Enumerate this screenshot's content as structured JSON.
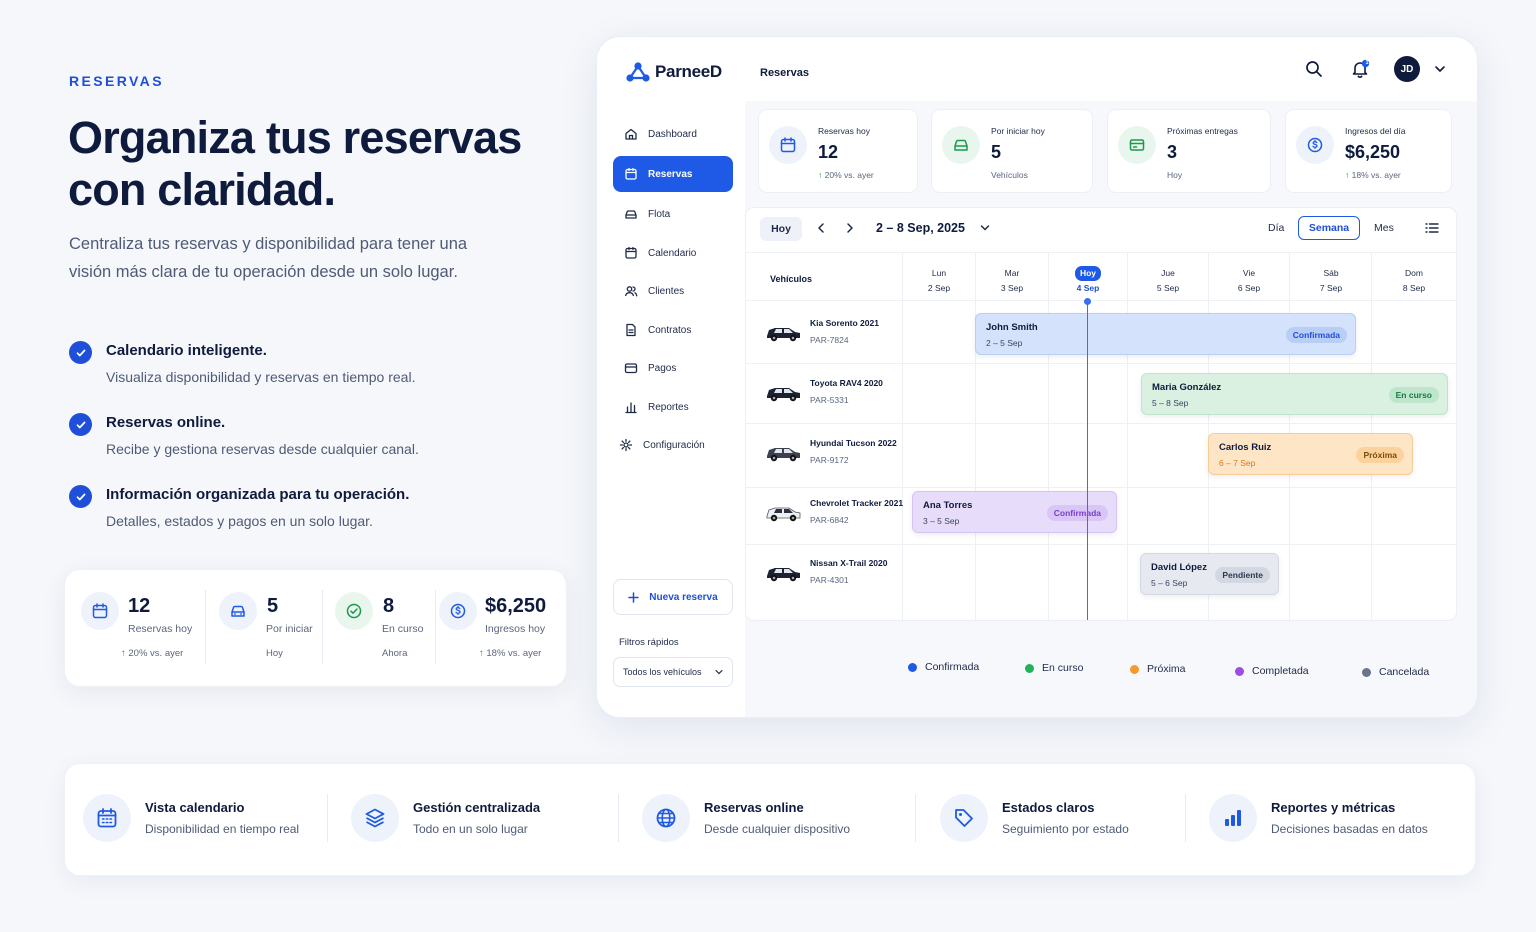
{
  "landing": {
    "eyebrow": "RESERVAS",
    "title": "Organiza tus reservas con claridad.",
    "lead": "Centraliza tus reservas y disponibilidad para tener una visión más clara de tu operación desde un solo lugar.",
    "features": [
      {
        "title": "Calendario inteligente.",
        "desc": "Visualiza disponibilidad y reservas en tiempo real."
      },
      {
        "title": "Reservas online.",
        "desc": "Recibe y gestiona reservas desde cualquier canal."
      },
      {
        "title": "Información organizada para tu operación.",
        "desc": "Detalles, estados y pagos en un solo lugar."
      }
    ],
    "stats": [
      {
        "icon": "calendar-icon",
        "value": "12",
        "label": "Reservas hoy",
        "sub": "20% vs. ayer"
      },
      {
        "icon": "car-icon",
        "value": "5",
        "label": "Por iniciar",
        "sub": "Hoy"
      },
      {
        "icon": "check-circle-icon",
        "value": "8",
        "label": "En curso",
        "sub": "Ahora"
      },
      {
        "icon": "dollar-icon",
        "value": "$6,250",
        "label": "Ingresos hoy",
        "sub": "18% vs. ayer"
      }
    ]
  },
  "app": {
    "brand": "ParneeD",
    "title": "Reservas",
    "avatar": "JD",
    "notifications": "1",
    "nav": [
      {
        "label": "Dashboard",
        "icon": "home-icon"
      },
      {
        "label": "Reservas",
        "icon": "calendar-icon"
      },
      {
        "label": "Flota",
        "icon": "car-icon"
      },
      {
        "label": "Calendario",
        "icon": "calendar-icon"
      },
      {
        "label": "Clientes",
        "icon": "users-icon"
      },
      {
        "label": "Contratos",
        "icon": "document-icon"
      },
      {
        "label": "Pagos",
        "icon": "wallet-icon"
      },
      {
        "label": "Reportes",
        "icon": "chart-icon"
      },
      {
        "label": "Configuración",
        "icon": "gear-icon"
      }
    ],
    "new_button": "Nueva reserva",
    "filters_title": "Filtros rápidos",
    "filter_value": "Todos los vehículos",
    "kpis": [
      {
        "label": "Reservas hoy",
        "value": "12",
        "sub": "20% vs. ayer",
        "icon": "calendar-icon",
        "color": "#1f5ae6"
      },
      {
        "label": "Por iniciar hoy",
        "value": "5",
        "sub": "Vehículos",
        "icon": "car-icon",
        "color": "#1a9a4b"
      },
      {
        "label": "Próximas entregas",
        "value": "3",
        "sub": "Hoy",
        "icon": "card-icon",
        "color": "#1a9a4b"
      },
      {
        "label": "Ingresos del día",
        "value": "$6,250",
        "sub": "18% vs. ayer",
        "icon": "dollar-icon",
        "color": "#1f5ae6"
      }
    ],
    "calendar": {
      "today_button": "Hoy",
      "range": "2 – 8 Sep, 2025",
      "views": [
        "Día",
        "Semana",
        "Mes"
      ],
      "active_view": "Semana",
      "vehicles_header": "Vehículos",
      "days": [
        {
          "name": "Lun",
          "date": "2 Sep"
        },
        {
          "name": "Mar",
          "date": "3 Sep"
        },
        {
          "name": "Hoy",
          "date": "4 Sep"
        },
        {
          "name": "Jue",
          "date": "5 Sep"
        },
        {
          "name": "Vie",
          "date": "6 Sep"
        },
        {
          "name": "Sáb",
          "date": "7 Sep"
        },
        {
          "name": "Dom",
          "date": "8 Sep"
        }
      ],
      "vehicles": [
        {
          "name": "Kia Sorento 2021",
          "plate": "PAR-7824"
        },
        {
          "name": "Toyota RAV4 2020",
          "plate": "PAR-5331"
        },
        {
          "name": "Hyundai Tucson 2022",
          "plate": "PAR-9172"
        },
        {
          "name": "Chevrolet Tracker 2021",
          "plate": "PAR-6842"
        },
        {
          "name": "Nissan X-Trail 2020",
          "plate": "PAR-4301"
        }
      ],
      "bookings": [
        {
          "name": "John Smith",
          "dates": "2 – 5 Sep",
          "status": "Confirmada"
        },
        {
          "name": "Maria González",
          "dates": "5 – 8 Sep",
          "status": "En curso"
        },
        {
          "name": "Carlos Ruiz",
          "dates": "6 – 7 Sep",
          "status": "Próxima"
        },
        {
          "name": "Ana Torres",
          "dates": "3 – 5 Sep",
          "status": "Confirmada"
        },
        {
          "name": "David López",
          "dates": "5 – 6 Sep",
          "status": "Pendiente"
        }
      ]
    },
    "legend": [
      {
        "label": "Confirmada",
        "color": "#1f5ae6"
      },
      {
        "label": "En curso",
        "color": "#22b35a"
      },
      {
        "label": "Próxima",
        "color": "#f59a2b"
      },
      {
        "label": "Completada",
        "color": "#9b4fe0"
      },
      {
        "label": "Cancelada",
        "color": "#6b7588"
      }
    ]
  },
  "benefits": [
    {
      "icon": "calendar-grid-icon",
      "title": "Vista calendario",
      "desc": "Disponibilidad en tiempo real"
    },
    {
      "icon": "layers-icon",
      "title": "Gestión centralizada",
      "desc": "Todo en un solo lugar"
    },
    {
      "icon": "globe-icon",
      "title": "Reservas online",
      "desc": "Desde cualquier dispositivo"
    },
    {
      "icon": "tag-icon",
      "title": "Estados claros",
      "desc": "Seguimiento por estado"
    },
    {
      "icon": "bar-chart-icon",
      "title": "Reportes y métricas",
      "desc": "Decisiones basadas en datos"
    }
  ]
}
